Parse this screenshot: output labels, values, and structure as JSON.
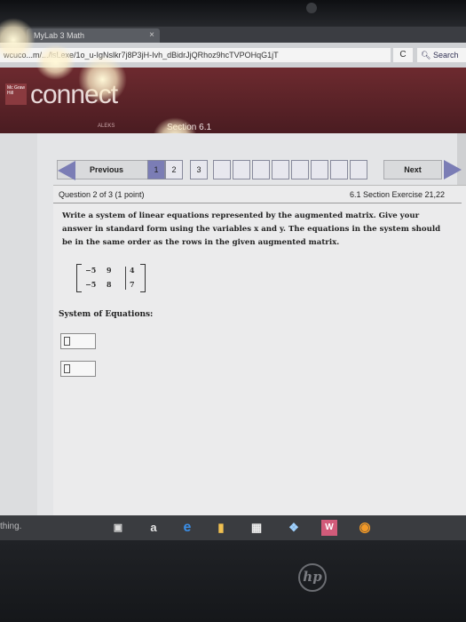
{
  "browser": {
    "tab_title": "MyLab 3 Math",
    "tab_close_glyph": "×",
    "url": "wcuco...m/.../lsLexe/1o_u-IgNslkr7j8P3jH-Ivh_dBidrJjQRhoz9hcTVPOHqG1jT",
    "refresh_glyph": "C",
    "search_placeholder": "Search"
  },
  "site": {
    "logo_text": "connect",
    "logo_box_text": "Mc Graw Hill",
    "section_label": "Section 6.1",
    "subnav_text": "ALEKS"
  },
  "nav": {
    "previous_label": "Previous",
    "next_label": "Next",
    "question_numbers": [
      "1",
      "2",
      "3",
      "",
      "",
      "",
      "",
      "",
      "",
      "",
      "",
      ""
    ]
  },
  "question": {
    "header": "Question 2 of 3 (1 point)",
    "section": "6.1 Section Exercise 21,22",
    "text": "Write a system of linear equations represented by the augmented matrix. Give your answer in standard form using the variables x and y. The equations in the system should be in the same order as the rows in the given augmented matrix.",
    "matrix": [
      [
        "−5",
        "9",
        "4"
      ],
      [
        "−5",
        "8",
        "7"
      ]
    ],
    "system_label": "System of Equations:"
  },
  "taskbar": {
    "search_text": "thing.",
    "icons": [
      "task-view-icon",
      "amazon-icon",
      "edge-icon",
      "file-explorer-icon",
      "store-icon",
      "dropbox-icon",
      "word-icon",
      "firefox-icon"
    ]
  },
  "brand": {
    "laptop_logo": "hp"
  },
  "colors": {
    "banner": "#6d2a2f",
    "nav_arrow": "#7b7db5",
    "content_bg": "#e4e5e7"
  }
}
